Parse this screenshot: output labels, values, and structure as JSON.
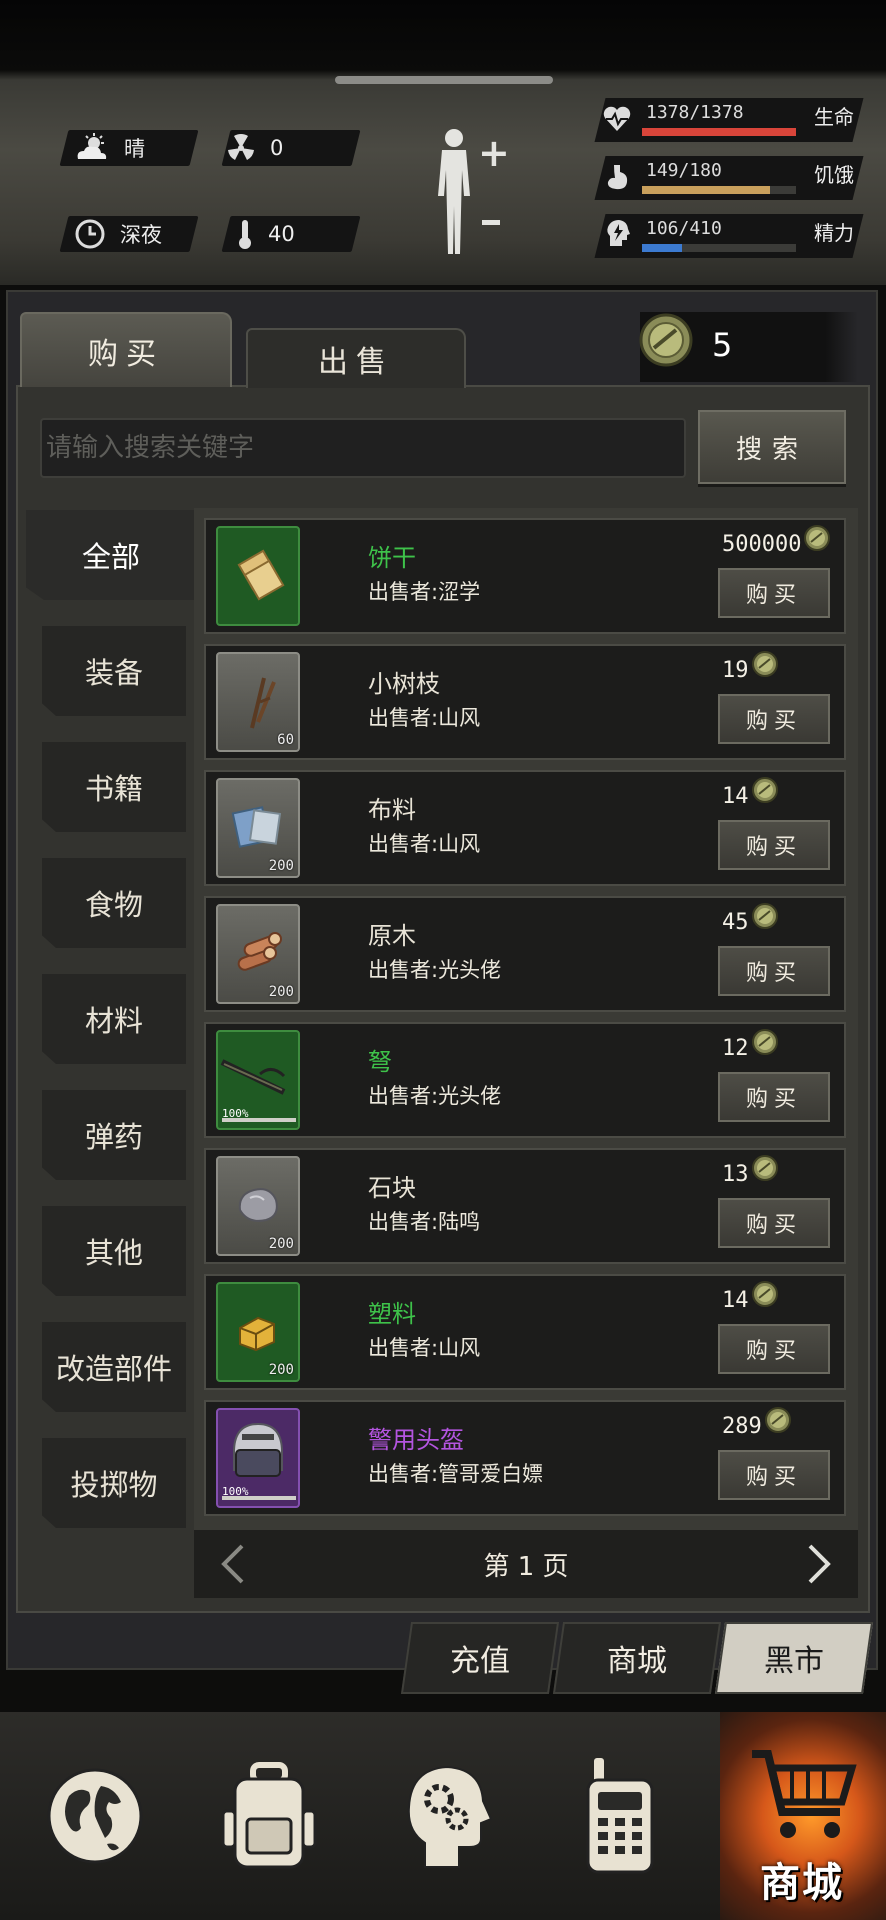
{
  "status": {
    "weather": "晴",
    "radiation": "0",
    "time_of_day": "深夜",
    "temperature": "40"
  },
  "vitals": [
    {
      "key": "health",
      "value": "1378/1378",
      "label": "生命",
      "fill": 1.0,
      "color": "#d9453a",
      "icon": "heart-pulse-icon"
    },
    {
      "key": "hunger",
      "value": "149/180",
      "label": "饥饿",
      "fill": 0.83,
      "color": "#c9a05c",
      "icon": "stomach-icon"
    },
    {
      "key": "energy",
      "value": "106/410",
      "label": "精力",
      "fill": 0.26,
      "color": "#3c7ad0",
      "icon": "lightning-head-icon"
    }
  ],
  "shop": {
    "tab_buy": "购买",
    "tab_sell": "出售",
    "coins": "5",
    "search_placeholder": "请输入搜索关键字",
    "search_label": "搜索",
    "buy_label": "购买",
    "page_label": "第 1 页"
  },
  "categories": [
    "全部",
    "装备",
    "书籍",
    "食物",
    "材料",
    "弹药",
    "其他",
    "改造部件",
    "投掷物"
  ],
  "items": [
    {
      "name": "饼干",
      "seller": "出售者:涩学",
      "price": "500000",
      "qty": "",
      "rarity": "green",
      "name_color": "#3ec24a",
      "icon": "biscuit-icon"
    },
    {
      "name": "小树枝",
      "seller": "出售者:山风",
      "price": "19",
      "qty": "60",
      "rarity": "gray",
      "name_color": "#e8e3d6",
      "icon": "twigs-icon"
    },
    {
      "name": "布料",
      "seller": "出售者:山风",
      "price": "14",
      "qty": "200",
      "rarity": "gray",
      "name_color": "#e8e3d6",
      "icon": "cloth-icon"
    },
    {
      "name": "原木",
      "seller": "出售者:光头佬",
      "price": "45",
      "qty": "200",
      "rarity": "gray",
      "name_color": "#e8e3d6",
      "icon": "logs-icon"
    },
    {
      "name": "弩",
      "seller": "出售者:光头佬",
      "price": "12",
      "qty": "",
      "durability": "100%",
      "rarity": "green",
      "name_color": "#3ec24a",
      "icon": "crossbow-icon"
    },
    {
      "name": "石块",
      "seller": "出售者:陆鸣",
      "price": "13",
      "qty": "200",
      "rarity": "gray",
      "name_color": "#e8e3d6",
      "icon": "stone-icon"
    },
    {
      "name": "塑料",
      "seller": "出售者:山风",
      "price": "14",
      "qty": "200",
      "rarity": "green",
      "name_color": "#3ec24a",
      "icon": "plastic-icon"
    },
    {
      "name": "警用头盔",
      "seller": "出售者:管哥爱白嫖",
      "price": "289",
      "qty": "",
      "durability": "100%",
      "rarity": "purple",
      "name_color": "#b455e0",
      "icon": "police-helmet-icon"
    }
  ],
  "bottom_tabs": [
    "充值",
    "商城",
    "黑市"
  ],
  "nav": {
    "shop_label": "商城"
  }
}
